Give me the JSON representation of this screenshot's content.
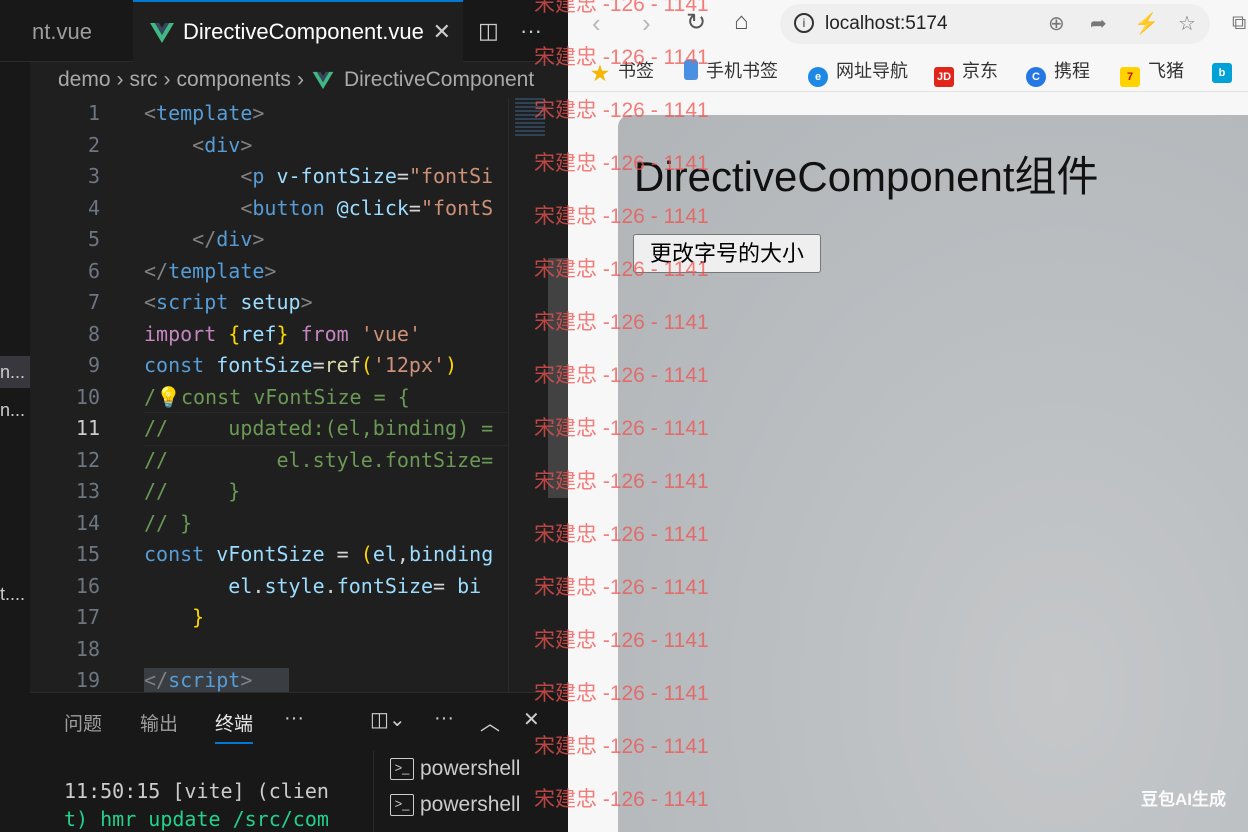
{
  "editor": {
    "tabs": [
      {
        "label": "nt.vue"
      },
      {
        "label": "DirectiveComponent.vue"
      }
    ],
    "breadcrumb": [
      "demo",
      "src",
      "components",
      "DirectiveComponent"
    ],
    "sidebar_fragments": [
      "n...",
      "n...",
      "t...."
    ],
    "line_numbers": [
      "1",
      "2",
      "3",
      "4",
      "5",
      "6",
      "7",
      "8",
      "9",
      "10",
      "11",
      "12",
      "13",
      "14",
      "15",
      "16",
      "17",
      "18",
      "19"
    ],
    "current_line": "11",
    "panel": {
      "tabs": [
        "问题",
        "输出",
        "终端"
      ],
      "terminal_lines": [
        "11:50:15 [vite] (clien",
        "t) hmr update /src/com"
      ],
      "terminals": [
        "powershell",
        "powershell"
      ]
    }
  },
  "browser": {
    "url": "localhost:5174",
    "bookmarks": [
      "书签",
      "手机书签",
      "网址导航",
      "京东",
      "携程",
      "飞猪"
    ],
    "page": {
      "heading": "DirectiveComponent组件",
      "button": "更改字号的大小"
    }
  },
  "watermark": "宋建忠 -126 - 1141",
  "ai_watermark": "豆包AI生成",
  "colors": {
    "accent": "#0078d4",
    "editor_bg": "#1f1f1f",
    "watermark": "#ef5350"
  },
  "icons": [
    "vue-icon",
    "close-icon",
    "split-editor-icon",
    "more-icon",
    "back-icon",
    "forward-icon",
    "reload-icon",
    "home-icon",
    "info-icon",
    "zoom-icon",
    "share-icon",
    "lightning-icon",
    "star-icon",
    "lightbulb-icon",
    "terminal-icon"
  ]
}
